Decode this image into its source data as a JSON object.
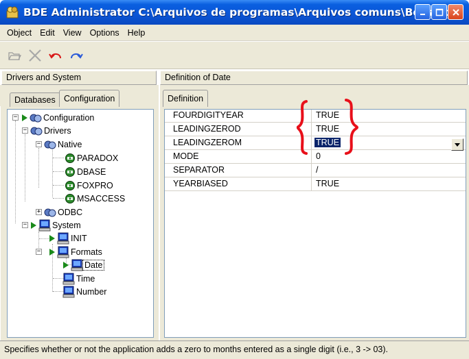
{
  "window": {
    "title": "BDE Administrator  C:\\Arquivos de programas\\Arquivos comuns\\Borland..."
  },
  "menu": [
    "Object",
    "Edit",
    "View",
    "Options",
    "Help"
  ],
  "panels": {
    "left_header": "Drivers and System",
    "right_header": "Definition of Date"
  },
  "tabs": {
    "left": [
      {
        "label": "Databases",
        "active": false
      },
      {
        "label": "Configuration",
        "active": true
      }
    ],
    "right": [
      {
        "label": "Definition",
        "active": true
      }
    ]
  },
  "tree": {
    "configuration": "Configuration",
    "drivers": "Drivers",
    "native": "Native",
    "paradox": "PARADOX",
    "dbase": "DBASE",
    "foxpro": "FOXPRO",
    "msaccess": "MSACCESS",
    "odbc": "ODBC",
    "system": "System",
    "init": "INIT",
    "formats": "Formats",
    "date": "Date",
    "time": "Time",
    "number": "Number"
  },
  "definition": [
    {
      "key": "FOURDIGITYEAR",
      "value": "TRUE"
    },
    {
      "key": "LEADINGZEROD",
      "value": "TRUE"
    },
    {
      "key": "LEADINGZEROM",
      "value": "TRUE"
    },
    {
      "key": "MODE",
      "value": "0"
    },
    {
      "key": "SEPARATOR",
      "value": "/"
    },
    {
      "key": "YEARBIASED",
      "value": "TRUE"
    }
  ],
  "status_text": "Specifies whether or not the application adds a zero to months entered as a single digit (i.e., 3 -> 03).",
  "colors": {
    "titlebar": "#0a55d6",
    "selection": "#0a246a",
    "annotation": "#e8101a",
    "arrow_green": "#1a8a1a"
  }
}
